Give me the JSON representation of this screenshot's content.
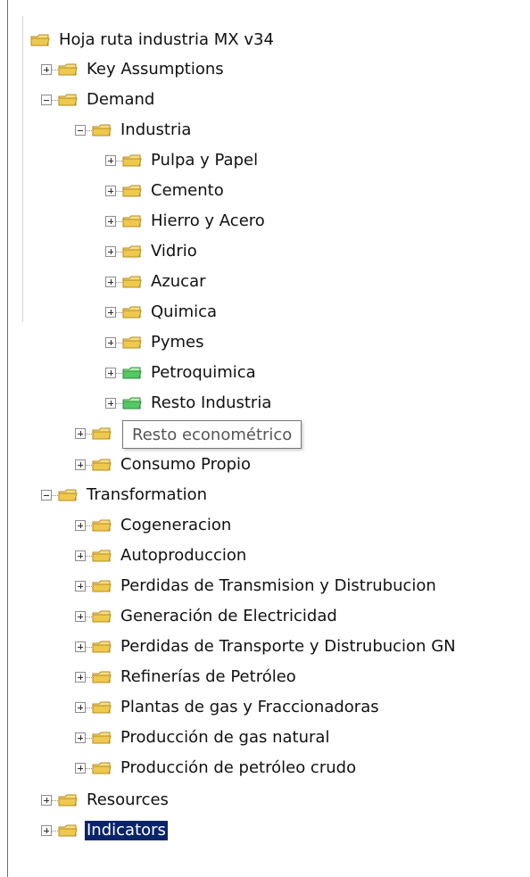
{
  "tree": {
    "root_label": "Hoja ruta industria MX v34",
    "key_assumptions": "Key Assumptions",
    "demand": "Demand",
    "industria": "Industria",
    "pulpa_y_papel": "Pulpa y Papel",
    "cemento": "Cemento",
    "hierro_y_acero": "Hierro y Acero",
    "vidrio": "Vidrio",
    "azucar": "Azucar",
    "quimica": "Quimica",
    "pymes": "Pymes",
    "petroquimica": "Petroquimica",
    "resto_industria": "Resto Industria",
    "consumo_propio": "Consumo Propio",
    "transformation": "Transformation",
    "cogeneracion": "Cogeneracion",
    "autoproduccion": "Autoproduccion",
    "perdidas_transmision": "Perdidas de Transmision y Distrubucion",
    "generacion_electricidad": "Generación de Electricidad",
    "perdidas_transporte": "Perdidas de Transporte y Distrubucion GN",
    "refinerias": "Refinerías de Petróleo",
    "plantas_gas": "Plantas de gas y Fraccionadoras",
    "produccion_gas": "Producción de gas natural",
    "produccion_petroleo": "Producción de petróleo crudo",
    "resources": "Resources",
    "indicators": "Indicators"
  },
  "tooltip": {
    "text": "Resto econométrico"
  },
  "colors": {
    "folder_yellow": "#f0c94c",
    "folder_green": "#4cc45b",
    "selection_blue": "#0a246a"
  },
  "icons": {
    "expand": "plus-box",
    "collapse": "minus-box",
    "folder": "folder-icon"
  }
}
